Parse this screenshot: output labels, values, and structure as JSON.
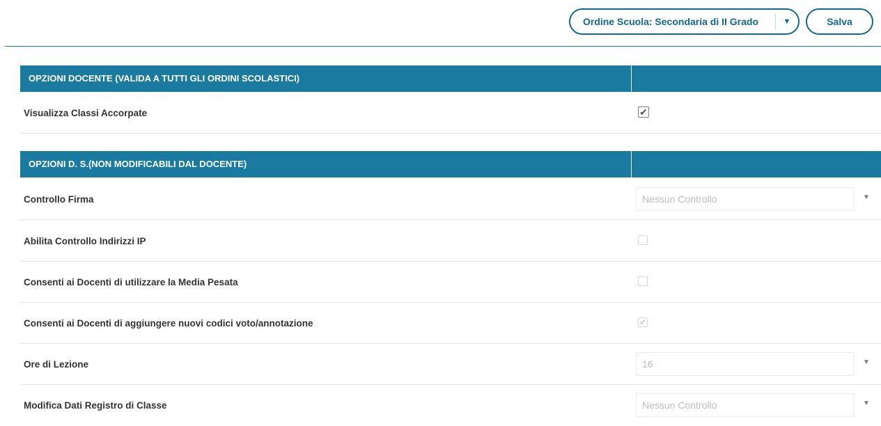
{
  "header": {
    "order_button_label": "Ordine Scuola: Secondaria di II Grado",
    "save_label": "Salva"
  },
  "sections": [
    {
      "title": "OPZIONI DOCENTE (VALIDA A TUTTI GLI ORDINI SCOLASTICI)",
      "rows": [
        {
          "label": "Visualizza Classi Accorpate",
          "control": "checkbox",
          "checked": true,
          "enabled": true
        }
      ]
    },
    {
      "title": "OPZIONI D. S.(NON MODIFICABILI DAL DOCENTE)",
      "rows": [
        {
          "label": "Controllo Firma",
          "control": "select",
          "value": "Nessun Controllo",
          "enabled": false
        },
        {
          "label": "Abilita Controllo Indirizzi IP",
          "control": "checkbox",
          "checked": false,
          "enabled": false
        },
        {
          "label": "Consenti ai Docenti di utilizzare la Media Pesata",
          "control": "checkbox",
          "checked": false,
          "enabled": false
        },
        {
          "label": "Consenti ai Docenti di aggiungere nuovi codici voto/annotazione",
          "control": "checkbox",
          "checked": true,
          "enabled": false
        },
        {
          "label": "Ore di Lezione",
          "control": "select",
          "value": "16",
          "enabled": false
        },
        {
          "label": "Modifica Dati Registro di Classe",
          "control": "select",
          "value": "Nessun Controllo",
          "enabled": false
        }
      ]
    }
  ],
  "colors": {
    "accent": "#1a7aa0",
    "button_border": "#11688d"
  },
  "icons": {
    "caret": "caret-down-icon",
    "check": "checkmark-icon"
  }
}
